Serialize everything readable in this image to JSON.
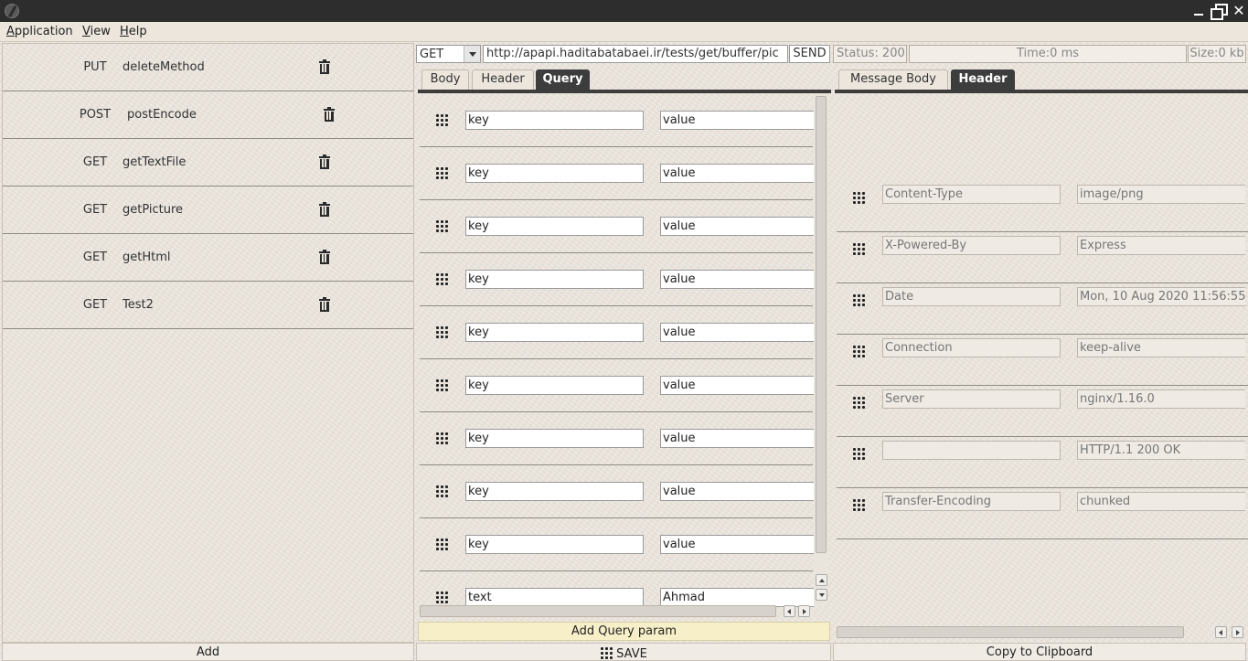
{
  "menu": {
    "items": [
      "Application",
      "View",
      "Help"
    ]
  },
  "window": {
    "close_glyph": "✕"
  },
  "requests": [
    {
      "method": "PUT",
      "name": "deleteMethod"
    },
    {
      "method": "POST",
      "name": "postEncode"
    },
    {
      "method": "GET",
      "name": "getTextFile"
    },
    {
      "method": "GET",
      "name": "getPicture"
    },
    {
      "method": "GET",
      "name": "getHtml"
    },
    {
      "method": "GET",
      "name": "Test2"
    }
  ],
  "left_footer": {
    "add_label": "Add"
  },
  "request_bar": {
    "method": "GET",
    "url": "http://apapi.haditabatabaei.ir/tests/get/buffer/pic",
    "send_label": "SEND"
  },
  "request_tabs": [
    "Body",
    "Header",
    "Query"
  ],
  "request_tabs_active": "Query",
  "query_params": [
    {
      "key": "key",
      "value": "value"
    },
    {
      "key": "key",
      "value": "value"
    },
    {
      "key": "key",
      "value": "value"
    },
    {
      "key": "key",
      "value": "value"
    },
    {
      "key": "key",
      "value": "value"
    },
    {
      "key": "key",
      "value": "value"
    },
    {
      "key": "key",
      "value": "value"
    },
    {
      "key": "key",
      "value": "value"
    },
    {
      "key": "key",
      "value": "value"
    },
    {
      "key": "text",
      "value": "Ahmad"
    }
  ],
  "add_query_label": "Add Query param",
  "save_label": "SAVE",
  "response": {
    "status": "Status: 200",
    "time": "Time:0 ms",
    "size": "Size:0 kb",
    "tabs": [
      "Message Body",
      "Header"
    ],
    "active_tab": "Header",
    "headers": [
      {
        "key": "Content-Type",
        "value": "image/png"
      },
      {
        "key": "X-Powered-By",
        "value": "Express"
      },
      {
        "key": "Date",
        "value": "Mon, 10 Aug 2020 11:56:55"
      },
      {
        "key": "Connection",
        "value": "keep-alive"
      },
      {
        "key": "Server",
        "value": "nginx/1.16.0"
      },
      {
        "key": "",
        "value": "HTTP/1.1 200 OK"
      },
      {
        "key": "Transfer-Encoding",
        "value": "chunked"
      }
    ],
    "copy_label": "Copy to Clipboard"
  },
  "colors": {
    "dark": "#3d3d3d",
    "accent_button": "#f6efc8",
    "paper": "#ece6dd"
  }
}
